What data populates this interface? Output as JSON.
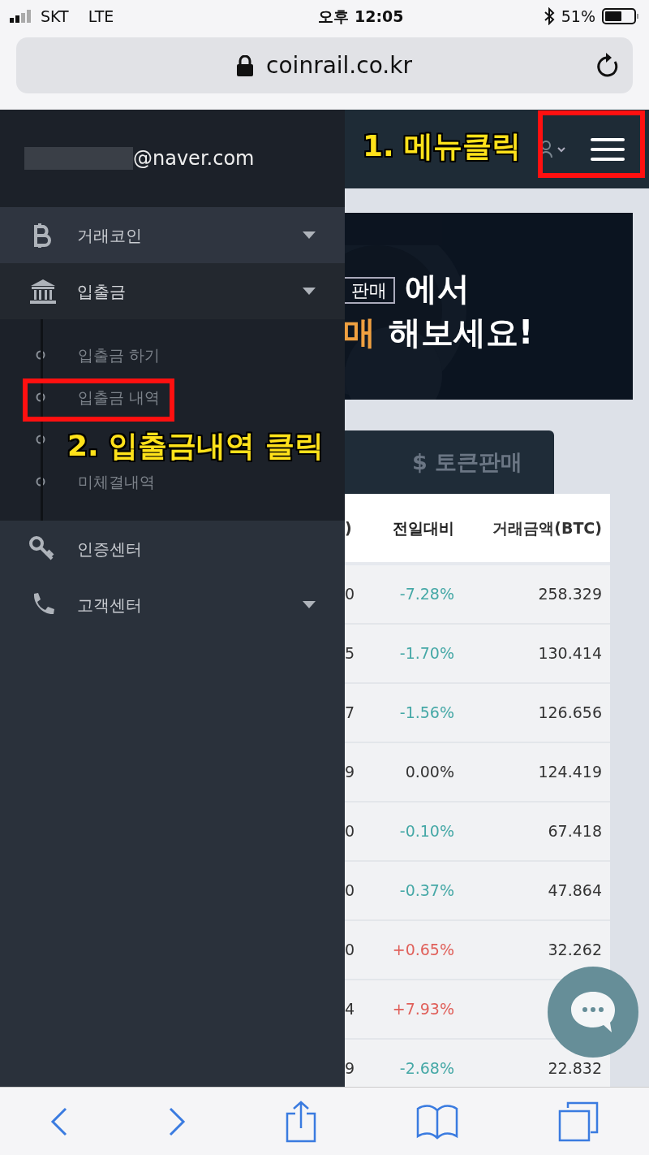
{
  "status_bar": {
    "carrier": "SKT",
    "network": "LTE",
    "time": "오후 12:05",
    "battery": "51%"
  },
  "address_bar": {
    "url": "coinrail.co.kr"
  },
  "drawer": {
    "email": "@naver.com",
    "items": [
      {
        "kind": "coin",
        "label": "거래코인",
        "expanded": false,
        "has_caret": true
      },
      {
        "kind": "bank",
        "label": "입출금",
        "expanded": true,
        "has_caret": true,
        "children": [
          {
            "kind": "entry",
            "label": "입출금 하기"
          },
          {
            "kind": "entry",
            "label": "입출금 내역"
          },
          {
            "kind": "covered"
          },
          {
            "kind": "entry",
            "label": "미체결내역"
          }
        ]
      },
      {
        "kind": "key",
        "label": "인증센터",
        "expanded": false,
        "has_caret": false
      },
      {
        "kind": "phone",
        "label": "고객센터",
        "expanded": false,
        "has_caret": true
      }
    ]
  },
  "banner": {
    "boxed": "판매",
    "line1": "에서",
    "highlight": "매",
    "line2": "해보세요!"
  },
  "tab": {
    "label": "$ 토큰판매"
  },
  "table": {
    "columns": [
      ")",
      "전일대비",
      "거래금액(BTC)"
    ],
    "rows": [
      {
        "cells": [
          "0",
          "-7.28%",
          "258.329"
        ],
        "color": "#45a8a6"
      },
      {
        "cells": [
          "5",
          "-1.70%",
          "130.414"
        ],
        "color": "#45a8a6"
      },
      {
        "cells": [
          "7",
          "-1.56%",
          "126.656"
        ],
        "color": "#45a8a6"
      },
      {
        "cells": [
          "9",
          "0.00%",
          "124.419"
        ],
        "color": "#333333"
      },
      {
        "cells": [
          "0",
          "-0.10%",
          "67.418"
        ],
        "color": "#45a8a6"
      },
      {
        "cells": [
          "0",
          "-0.37%",
          "47.864"
        ],
        "color": "#45a8a6"
      },
      {
        "cells": [
          "0",
          "+0.65%",
          "32.262"
        ],
        "color": "#e0605a"
      },
      {
        "cells": [
          "4",
          "+7.93%"
        ],
        "color": "#e0605a"
      },
      {
        "cells": [
          "9",
          "-2.68%",
          "22.832"
        ],
        "color": "#45a8a6"
      }
    ]
  },
  "annotations": [
    "1. 메뉴클릭",
    "2. 입출금내역 클릭"
  ]
}
